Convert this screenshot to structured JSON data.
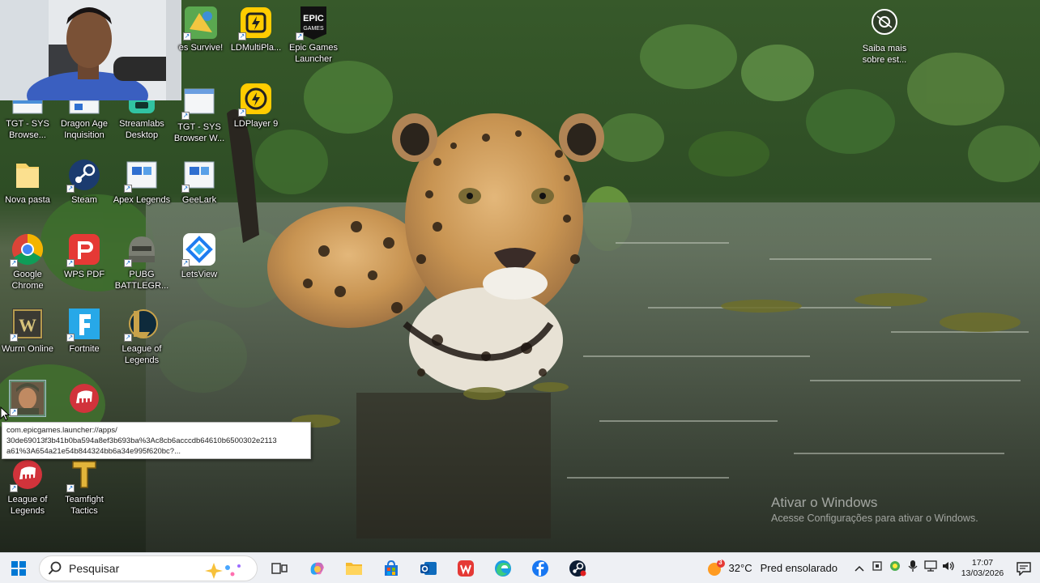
{
  "desktop": {
    "icons": [
      {
        "label": "es Survive!",
        "icon": "game-survival-icon"
      },
      {
        "label": "LDMultiPla...",
        "icon": "ldmultiplayer-icon"
      },
      {
        "label": "Epic Games Launcher",
        "icon": "epic-games-icon"
      },
      {
        "label": "TGT - SYS Browse...",
        "icon": "tgt-sys-browser-icon"
      },
      {
        "label": "Dragon Age Inquisition",
        "icon": "dragon-age-icon"
      },
      {
        "label": "Streamlabs Desktop",
        "icon": "streamlabs-icon"
      },
      {
        "label": "TGT - SYS Browser W...",
        "icon": "tgt-sys-browser-icon"
      },
      {
        "label": "LDPlayer 9",
        "icon": "ldplayer-icon"
      },
      {
        "label": "Nova pasta",
        "icon": "folder-icon"
      },
      {
        "label": "Steam",
        "icon": "steam-icon"
      },
      {
        "label": "Apex Legends",
        "icon": "apex-legends-icon"
      },
      {
        "label": "GeeLark",
        "icon": "geelark-icon"
      },
      {
        "label": "Google Chrome",
        "icon": "chrome-icon"
      },
      {
        "label": "WPS PDF",
        "icon": "wps-pdf-icon"
      },
      {
        "label": "PUBG BATTLEGR...",
        "icon": "pubg-icon"
      },
      {
        "label": "LetsView",
        "icon": "letsview-icon"
      },
      {
        "label": "Wurm Online",
        "icon": "wurm-online-icon"
      },
      {
        "label": "Fortnite",
        "icon": "fortnite-icon"
      },
      {
        "label": "League of Legends",
        "icon": "league-of-legends-icon"
      },
      {
        "label": "",
        "icon": "game-soldier-icon"
      },
      {
        "label": "",
        "icon": "riot-client-icon"
      },
      {
        "label": "League of Legends",
        "icon": "riot-client-icon"
      },
      {
        "label": "Teamfight Tactics",
        "icon": "teamfight-tactics-icon"
      }
    ],
    "tooltip": {
      "line1": "com.epicgames.launcher://apps/",
      "line2": "30de69013f3b41b0ba594a8ef3b693ba%3Ac8cb6acccdb64610b6500302e2113",
      "line3": "a61%3A654a21e54b844324bb6a34e995f620bc?..."
    },
    "saiba_mais": {
      "label": "Saiba mais sobre est...",
      "icon": "camera-icon"
    }
  },
  "watermark": {
    "title": "Ativar o Windows",
    "subtitle": "Acesse Configurações para ativar o Windows."
  },
  "taskbar": {
    "search_placeholder": "Pesquisar",
    "apps": [
      "task-view-icon",
      "copilot-icon",
      "file-explorer-icon",
      "microsoft-store-icon",
      "outlook-icon",
      "wps-office-icon",
      "edge-icon",
      "facebook-icon",
      "steam-taskbar-icon"
    ],
    "weather": {
      "temp": "32°C",
      "condition": "Pred ensolarado",
      "badge": "3"
    },
    "clock": {
      "time": "17:07",
      "date": "13/03/2026"
    },
    "colors": {
      "taskbar_bg": "#eef0f4",
      "accent": "#0078d4"
    }
  }
}
